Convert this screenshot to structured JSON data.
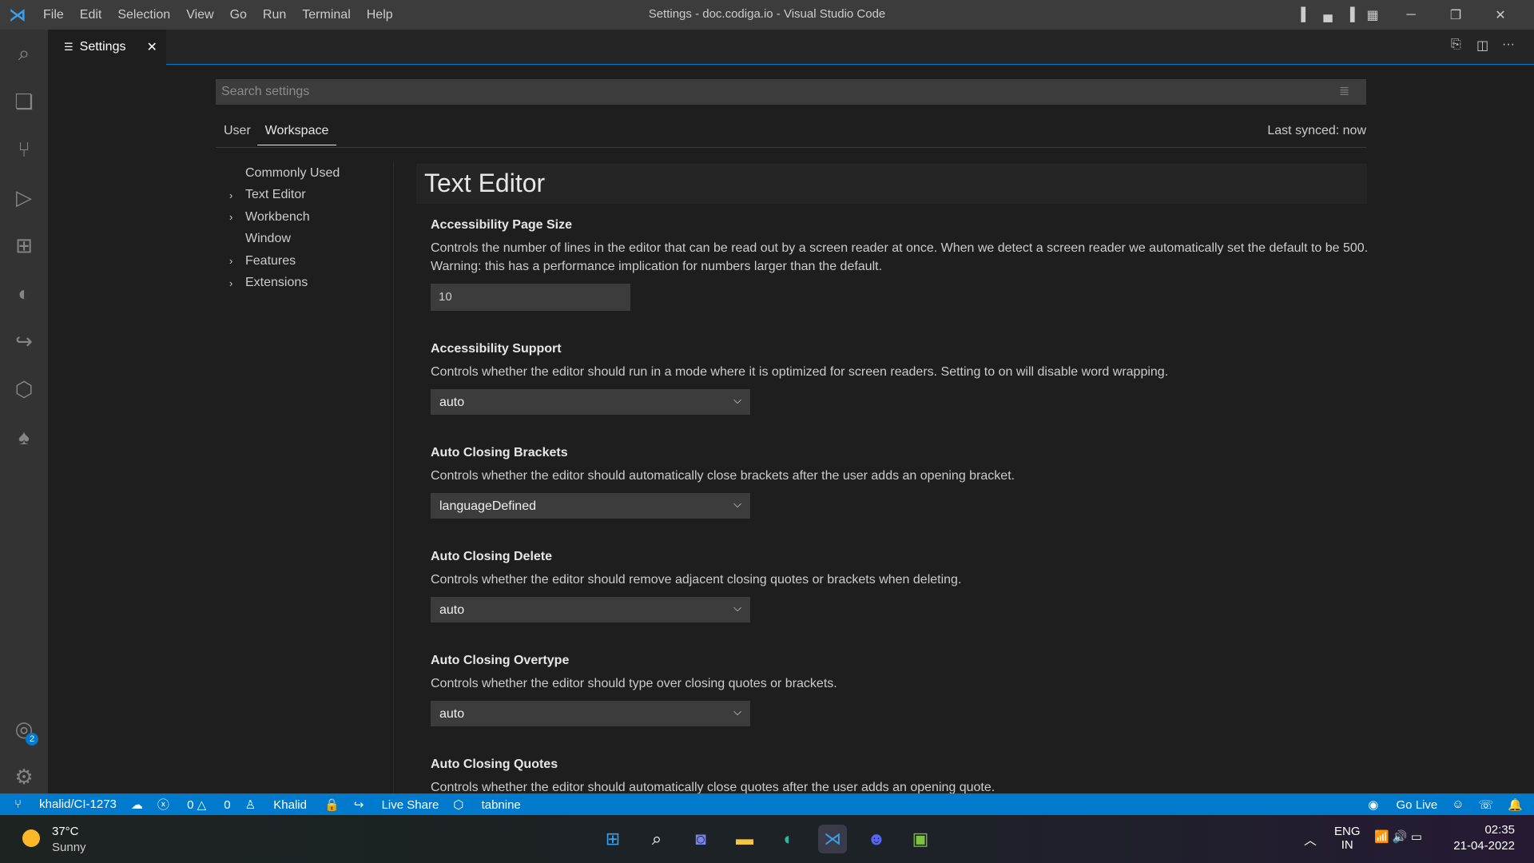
{
  "window": {
    "title": "Settings - doc.codiga.io - Visual Studio Code",
    "menu": [
      "File",
      "Edit",
      "Selection",
      "View",
      "Go",
      "Run",
      "Terminal",
      "Help"
    ]
  },
  "tab": {
    "label": "Settings"
  },
  "search": {
    "placeholder": "Search settings"
  },
  "scope_tabs": {
    "user": "User",
    "workspace": "Workspace",
    "sync": "Last synced: now"
  },
  "toc": [
    {
      "label": "Commonly Used",
      "expandable": false
    },
    {
      "label": "Text Editor",
      "expandable": true
    },
    {
      "label": "Workbench",
      "expandable": true
    },
    {
      "label": "Window",
      "expandable": false
    },
    {
      "label": "Features",
      "expandable": true
    },
    {
      "label": "Extensions",
      "expandable": true
    }
  ],
  "section_title": "Text Editor",
  "settings": [
    {
      "title": "Accessibility Page Size",
      "desc": "Controls the number of lines in the editor that can be read out by a screen reader at once. When we detect a screen reader we automatically set the default to be 500. Warning: this has a performance implication for numbers larger than the default.",
      "value": "10"
    },
    {
      "title": "Accessibility Support",
      "desc": "Controls whether the editor should run in a mode where it is optimized for screen readers. Setting to on will disable word wrapping.",
      "value": "auto"
    },
    {
      "title": "Auto Closing Brackets",
      "desc": "Controls whether the editor should automatically close brackets after the user adds an opening bracket.",
      "value": "languageDefined"
    },
    {
      "title": "Auto Closing Delete",
      "desc": "Controls whether the editor should remove adjacent closing quotes or brackets when deleting.",
      "value": "auto"
    },
    {
      "title": "Auto Closing Overtype",
      "desc": "Controls whether the editor should type over closing quotes or brackets.",
      "value": "auto"
    },
    {
      "title": "Auto Closing Quotes",
      "desc": "Controls whether the editor should automatically close quotes after the user adds an opening quote."
    }
  ],
  "accounts_badge": "2",
  "status": {
    "branch": "khalid/CI-1273",
    "errors": "0",
    "warnings": "0",
    "user": "Khalid",
    "liveshare": "Live Share",
    "tabnine": "tabnine",
    "golive": "Go Live"
  },
  "taskbar": {
    "temp": "37°C",
    "weather": "Sunny",
    "lang1": "ENG",
    "lang2": "IN",
    "time": "02:35",
    "date": "21-04-2022"
  },
  "colors": {
    "accent": "#007acc",
    "bg": "#1e1e1e"
  }
}
